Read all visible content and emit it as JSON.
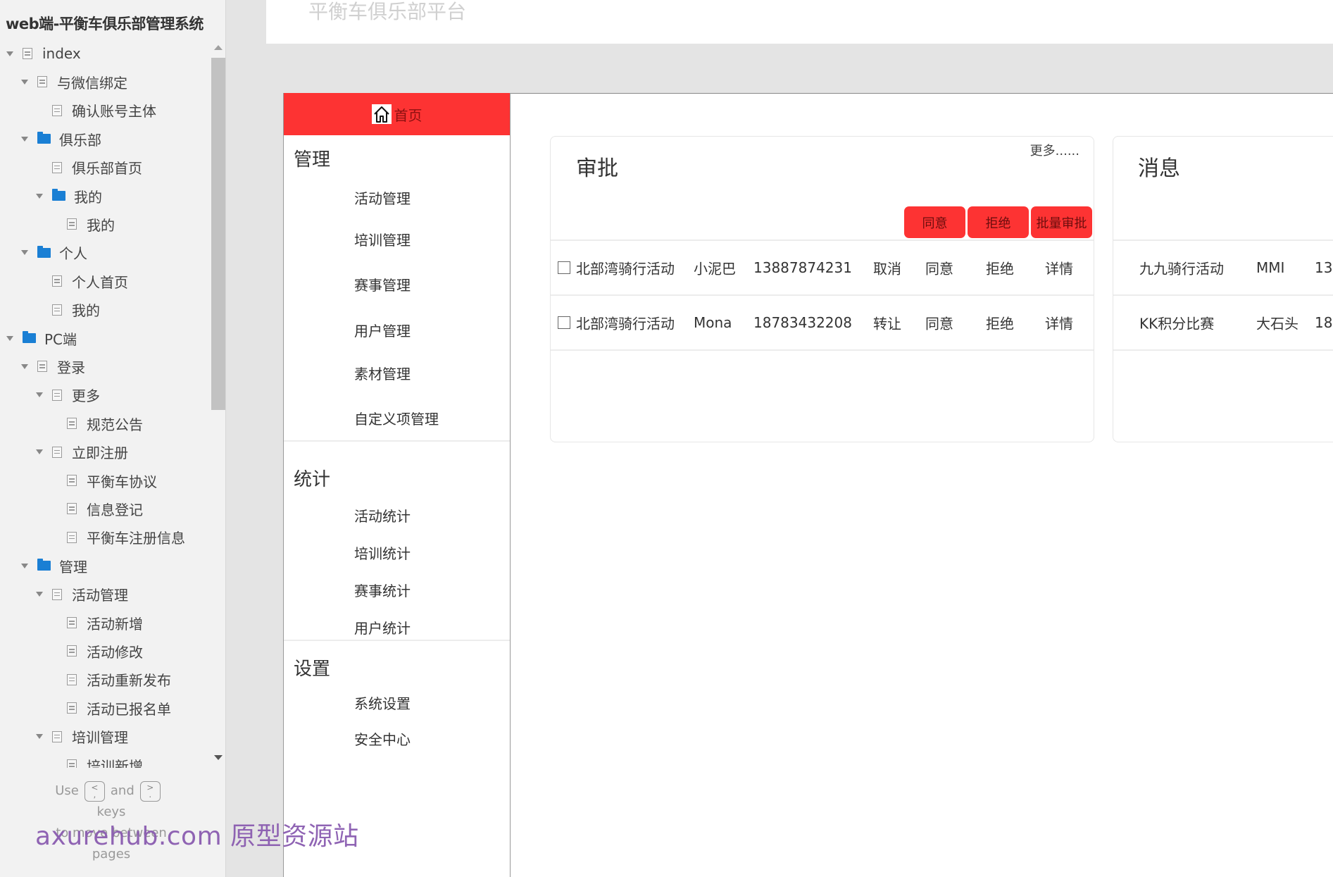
{
  "sidebar": {
    "project_title": "web端-平衡车俱乐部管理系统",
    "tree": [
      {
        "label": "index",
        "icon": "page",
        "depth": 0,
        "expanded": true
      },
      {
        "label": "与微信绑定",
        "icon": "page",
        "depth": 1,
        "expanded": true
      },
      {
        "label": "确认账号主体",
        "icon": "page",
        "depth": 2,
        "expanded": null
      },
      {
        "label": "俱乐部",
        "icon": "folder",
        "depth": 1,
        "expanded": true
      },
      {
        "label": "俱乐部首页",
        "icon": "page",
        "depth": 2,
        "expanded": null
      },
      {
        "label": "我的",
        "icon": "folder",
        "depth": 2,
        "expanded": true
      },
      {
        "label": "我的",
        "icon": "page",
        "depth": 3,
        "expanded": null
      },
      {
        "label": "个人",
        "icon": "folder",
        "depth": 1,
        "expanded": true
      },
      {
        "label": "个人首页",
        "icon": "page",
        "depth": 2,
        "expanded": null
      },
      {
        "label": "我的",
        "icon": "page",
        "depth": 2,
        "expanded": null
      },
      {
        "label": "PC端",
        "icon": "folder",
        "depth": 0,
        "expanded": true
      },
      {
        "label": "登录",
        "icon": "page",
        "depth": 1,
        "expanded": true
      },
      {
        "label": "更多",
        "icon": "page",
        "depth": 2,
        "expanded": true
      },
      {
        "label": "规范公告",
        "icon": "page",
        "depth": 3,
        "expanded": null
      },
      {
        "label": "立即注册",
        "icon": "page",
        "depth": 2,
        "expanded": true
      },
      {
        "label": "平衡车协议",
        "icon": "page",
        "depth": 3,
        "expanded": null
      },
      {
        "label": "信息登记",
        "icon": "page",
        "depth": 3,
        "expanded": null
      },
      {
        "label": "平衡车注册信息",
        "icon": "page",
        "depth": 3,
        "expanded": null
      },
      {
        "label": "管理",
        "icon": "folder",
        "depth": 1,
        "expanded": true
      },
      {
        "label": "活动管理",
        "icon": "page",
        "depth": 2,
        "expanded": true
      },
      {
        "label": "活动新增",
        "icon": "page",
        "depth": 3,
        "expanded": null
      },
      {
        "label": "活动修改",
        "icon": "page",
        "depth": 3,
        "expanded": null
      },
      {
        "label": "活动重新发布",
        "icon": "page",
        "depth": 3,
        "expanded": null
      },
      {
        "label": "活动已报名单",
        "icon": "page",
        "depth": 3,
        "expanded": null
      },
      {
        "label": "培训管理",
        "icon": "page",
        "depth": 2,
        "expanded": true
      },
      {
        "label": "培训新增",
        "icon": "page",
        "depth": 3,
        "expanded": null
      }
    ],
    "hint": {
      "use": "Use",
      "key_prev_top": "<",
      "key_prev_bottom": ",",
      "and": "and",
      "key_next_top": ">",
      "key_next_bottom": ".",
      "keys": "keys",
      "to_move": "to move between",
      "pages": "pages"
    }
  },
  "header": {
    "site_title": "平衡车俱乐部平台"
  },
  "nav": {
    "home_label": "首页",
    "groups": [
      {
        "title": "管理",
        "items": [
          "活动管理",
          "培训管理",
          "赛事管理",
          "用户管理",
          "素材管理",
          "自定义项管理"
        ]
      },
      {
        "title": "统计",
        "items": [
          "活动统计",
          "培训统计",
          "赛事统计",
          "用户统计"
        ]
      },
      {
        "title": "设置",
        "items": [
          "系统设置",
          "安全中心"
        ]
      }
    ]
  },
  "colors": {
    "accent_red": "#fd3333",
    "folder_blue": "#1a7fd4",
    "watermark_purple": "#8a5cb0"
  },
  "approval": {
    "title": "审批",
    "more_link": "更多......",
    "actions": [
      "同意",
      "拒绝",
      "批量审批"
    ],
    "rows": [
      {
        "checked": false,
        "activity": "北部湾骑行活动",
        "user": "小泥巴",
        "phone": "13887874231",
        "type": "取消",
        "approve": "同意",
        "reject": "拒绝",
        "detail": "详情"
      },
      {
        "checked": false,
        "activity": "北部湾骑行活动",
        "user": "Mona",
        "phone": "18783432208",
        "type": "转让",
        "approve": "同意",
        "reject": "拒绝",
        "detail": "详情"
      }
    ]
  },
  "messages": {
    "title": "消息",
    "rows": [
      {
        "activity": "九九骑行活动",
        "user": "MMI",
        "phone_partial": "13"
      },
      {
        "activity": "KK积分比赛",
        "user": "大石头",
        "phone_partial": "18"
      }
    ]
  },
  "watermark": "axurehub.com 原型资源站"
}
